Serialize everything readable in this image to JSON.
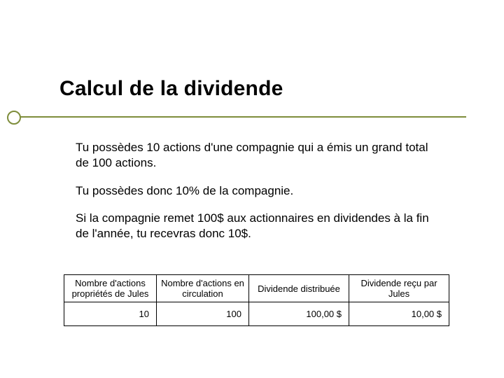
{
  "title": "Calcul de la dividende",
  "paragraphs": {
    "p1": "Tu possèdes 10 actions d'une compagnie qui a émis un grand total de 100 actions.",
    "p2": "Tu  possèdes donc 10% de la compagnie.",
    "p3": "Si la compagnie remet 100$ aux actionnaires en dividendes à la fin de l'année, tu recevras donc 10$."
  },
  "table": {
    "headers": {
      "h0": "Nombre d'actions propriétés de Jules",
      "h1": "Nombre d'actions en circulation",
      "h2": "Dividende distribuée",
      "h3": "Dividende reçu par Jules"
    },
    "row": {
      "c0": "10",
      "c1": "100",
      "c2": "100,00  $",
      "c3": "10,00  $"
    }
  },
  "chart_data": {
    "type": "table",
    "title": "Calcul de la dividende",
    "columns": [
      "Nombre d'actions propriétés de Jules",
      "Nombre d'actions en circulation",
      "Dividende distribuée",
      "Dividende reçu par Jules"
    ],
    "rows": [
      [
        10,
        100,
        "100,00 $",
        "10,00 $"
      ]
    ]
  }
}
